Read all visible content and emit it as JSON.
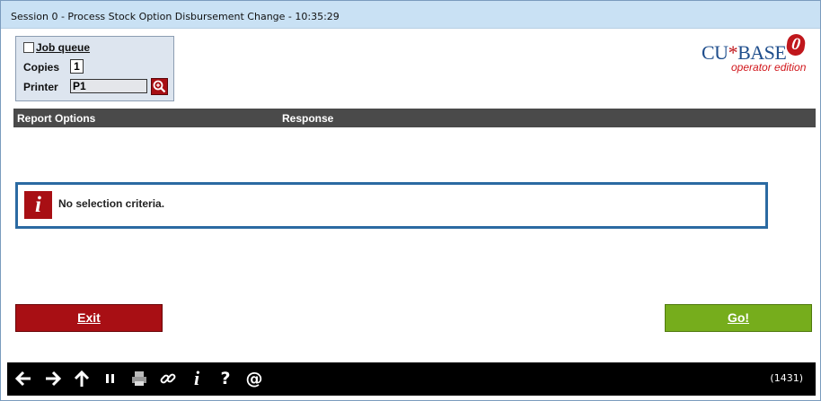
{
  "window": {
    "title": "Session 0  - Process Stock Option Disbursement Change - 10:35:29"
  },
  "job_panel": {
    "job_queue_label": "Job queue",
    "job_queue_checked": false,
    "copies_label": "Copies",
    "copies_value": "1",
    "printer_label": "Printer",
    "printer_value": "P1"
  },
  "logo": {
    "brand_left": "CU",
    "brand_star": "*",
    "brand_right": "BASE",
    "edition": "operator edition",
    "zero": "0"
  },
  "report_header": {
    "col1": "Report Options",
    "col2": "Response"
  },
  "message": {
    "text": "No selection criteria."
  },
  "buttons": {
    "exit_label": "Exit",
    "go_label": "Go!"
  },
  "toolbar": {
    "icons": [
      "arrow-left-icon",
      "arrow-right-icon",
      "arrow-up-icon",
      "pause-icon",
      "printer-icon",
      "link-icon",
      "info-icon",
      "help-icon",
      "at-icon"
    ],
    "code": "(1431)"
  },
  "colors": {
    "title_bar": "#c9e1f4",
    "exit_button": "#a80f14",
    "go_button": "#76ad1c",
    "header_bar": "#4a4a4a",
    "message_border": "#2b6aa2",
    "toolbar": "#000000"
  }
}
